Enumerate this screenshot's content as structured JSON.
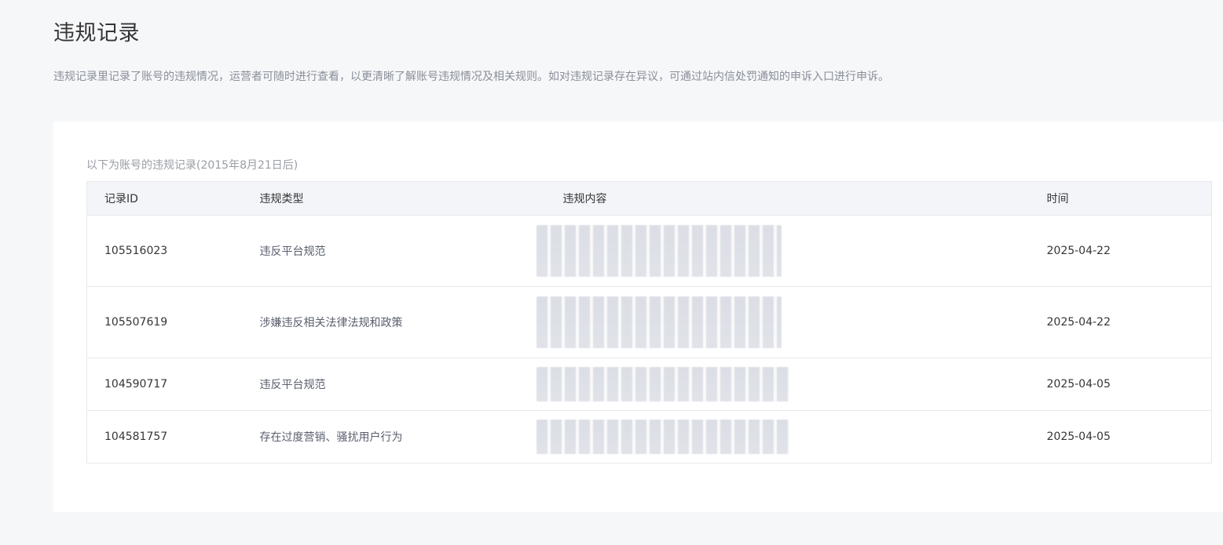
{
  "page": {
    "title": "违规记录",
    "description": "违规记录里记录了账号的违规情况，运营者可随时进行查看，以更清晰了解账号违规情况及相关规则。如对违规记录存在异议，可通过站内信处罚通知的申诉入口进行申诉。"
  },
  "records": {
    "caption": "以下为账号的违规记录(2015年8月21日后)",
    "columns": {
      "id": "记录ID",
      "type": "违规类型",
      "content": "违规内容",
      "time": "时间"
    },
    "rows": [
      {
        "id": "105516023",
        "type": "违反平台规范",
        "time": "2025-04-22"
      },
      {
        "id": "105507619",
        "type": "涉嫌违反相关法律法规和政策",
        "time": "2025-04-22"
      },
      {
        "id": "104590717",
        "type": "违反平台规范",
        "time": "2025-04-05"
      },
      {
        "id": "104581757",
        "type": "存在过度营销、骚扰用户行为",
        "time": "2025-04-05"
      }
    ]
  }
}
